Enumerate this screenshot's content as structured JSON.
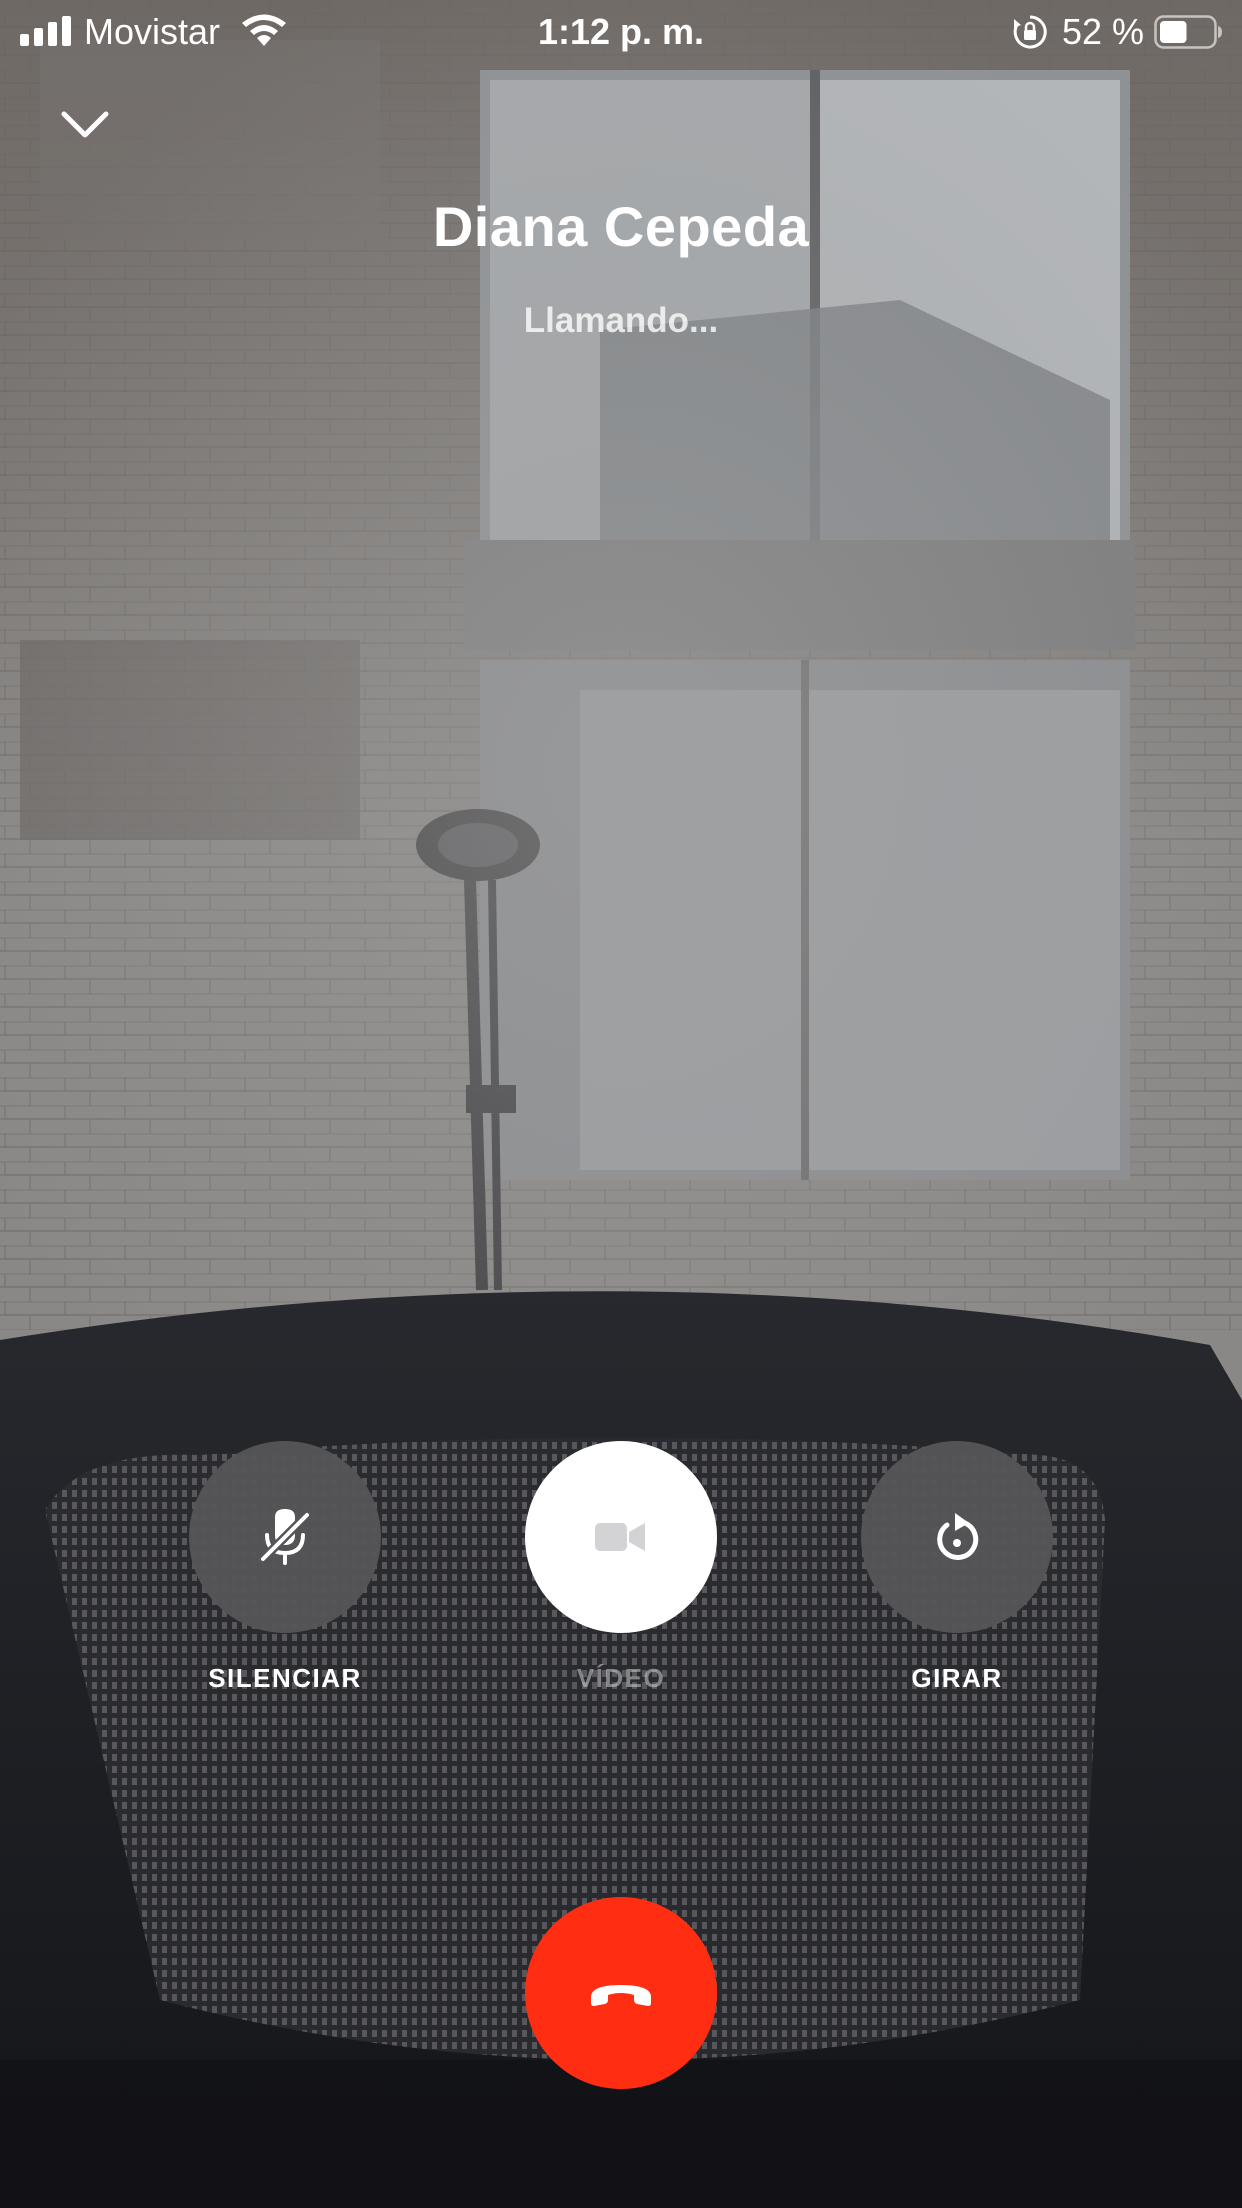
{
  "status_bar": {
    "carrier": "Movistar",
    "time": "1:12 p. m.",
    "battery_percent": "52 %",
    "battery_level": 0.52,
    "icons": [
      "cellular-signal-icon",
      "wifi-icon",
      "orientation-lock-icon",
      "battery-icon"
    ]
  },
  "call": {
    "contact_name": "Diana Cepeda",
    "status": "Llamando..."
  },
  "controls": {
    "mute_label": "SILENCIAR",
    "video_label": "VÍDEO",
    "flip_label": "GIRAR",
    "mute_icon": "microphone-off-icon",
    "video_icon": "video-camera-icon",
    "flip_icon": "rotate-camera-icon",
    "end_call_icon": "hang-up-icon"
  },
  "colors": {
    "end_call": "#ff2d12",
    "control_dark": "#555558",
    "control_light": "#ffffff"
  }
}
